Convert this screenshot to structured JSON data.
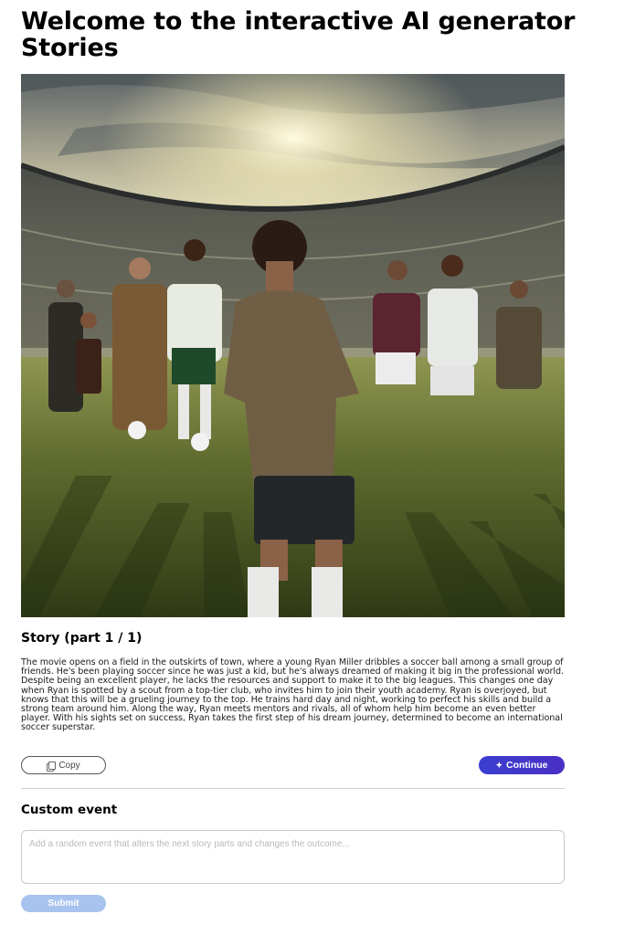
{
  "page": {
    "title": "Welcome to the interactive AI generator Stories"
  },
  "story": {
    "heading": "Story (part 1 / 1)",
    "text": "The movie opens on a field in the outskirts of town, where a young Ryan Miller dribbles a soccer ball among a small group of friends. He's been playing soccer since he was just a kid, but he's always dreamed of making it big in the professional world. Despite being an excellent player, he lacks the resources and support to make it to the big leagues. This changes one day when Ryan is spotted by a scout from a top-tier club, who invites him to join their youth academy. Ryan is overjoyed, but knows that this will be a grueling journey to the top. He trains hard day and night, working to perfect his skills and build a strong team around him. Along the way, Ryan meets mentors and rivals, all of whom help him become an even better player. With his sights set on success, Ryan takes the first step of his dream journey, determined to become an international soccer superstar.",
    "copy_label": "Copy",
    "continue_label": "Continue"
  },
  "custom_event": {
    "heading": "Custom event",
    "placeholder": "Add a random event that alters the next story parts and changes the outcome...",
    "value": "",
    "submit_label": "Submit"
  },
  "icons": {
    "copy": "copy-icon",
    "continue": "sparkle-icon"
  },
  "colors": {
    "continue_button": "#3a3fd0",
    "submit_button": "#a9c3ef",
    "divider": "#cfcfcf"
  }
}
